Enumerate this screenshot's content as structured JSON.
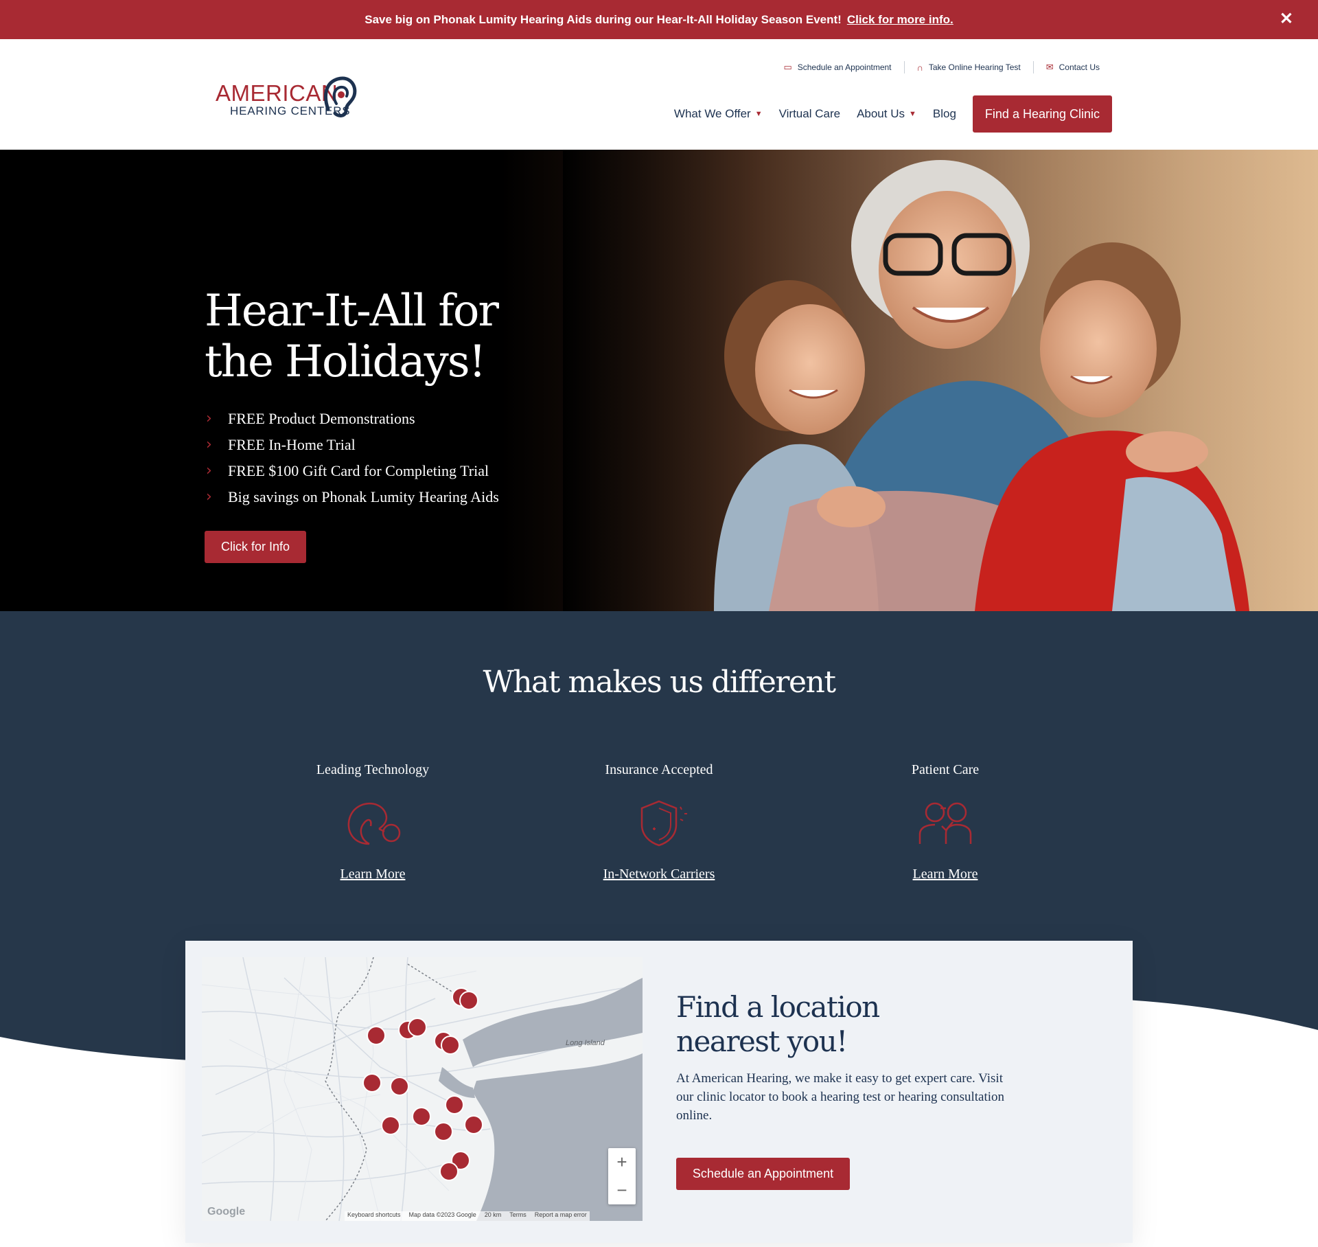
{
  "promo": {
    "text": "Save big on Phonak Lumity Hearing Aids during our Hear-It-All Holiday Season Event!",
    "link": "Click for more info.",
    "close": "✕"
  },
  "header": {
    "logo_line1": "AMERICAN",
    "logo_line2": "HEARING CENTERS",
    "utility": [
      {
        "icon": "calendar-icon",
        "label": "Schedule an Appointment"
      },
      {
        "icon": "headphones-icon",
        "label": "Take Online Hearing Test"
      },
      {
        "icon": "mail-icon",
        "label": "Contact Us"
      }
    ],
    "nav": [
      {
        "label": "What We Offer",
        "dropdown": true
      },
      {
        "label": "Virtual Care",
        "dropdown": false
      },
      {
        "label": "About Us",
        "dropdown": true
      },
      {
        "label": "Blog",
        "dropdown": false
      }
    ],
    "cta": "Find a Hearing Clinic"
  },
  "hero": {
    "title": "Hear-It-All for the Holidays!",
    "bullets": [
      "FREE Product Demonstrations",
      "FREE In-Home Trial",
      "FREE $100 Gift Card for Completing Trial",
      "Big savings on Phonak Lumity Hearing Aids"
    ],
    "button": "Click for Info"
  },
  "different": {
    "title": "What makes us different",
    "features": [
      {
        "title": "Leading Technology",
        "icon": "hearing-aid-icon",
        "link": "Learn More"
      },
      {
        "title": "Insurance Accepted",
        "icon": "shield-icon",
        "link": "In-Network Carriers"
      },
      {
        "title": "Patient Care",
        "icon": "patient-care-icon",
        "link": "Learn More"
      }
    ]
  },
  "location": {
    "title": "Find a location nearest you!",
    "text": "At American Hearing, we make it easy to get expert care. Visit our clinic locator to book a hearing test or hearing consultation online.",
    "button": "Schedule an Appointment",
    "map": {
      "label_long_island": "Long Island",
      "zoom_in": "+",
      "zoom_out": "−",
      "google": "Google",
      "attribution": [
        "Keyboard shortcuts",
        "Map data ©2023 Google",
        "20 km",
        "Terms",
        "Report a map error"
      ]
    }
  },
  "colors": {
    "brand": "#a82a33",
    "navy": "#26374a"
  }
}
